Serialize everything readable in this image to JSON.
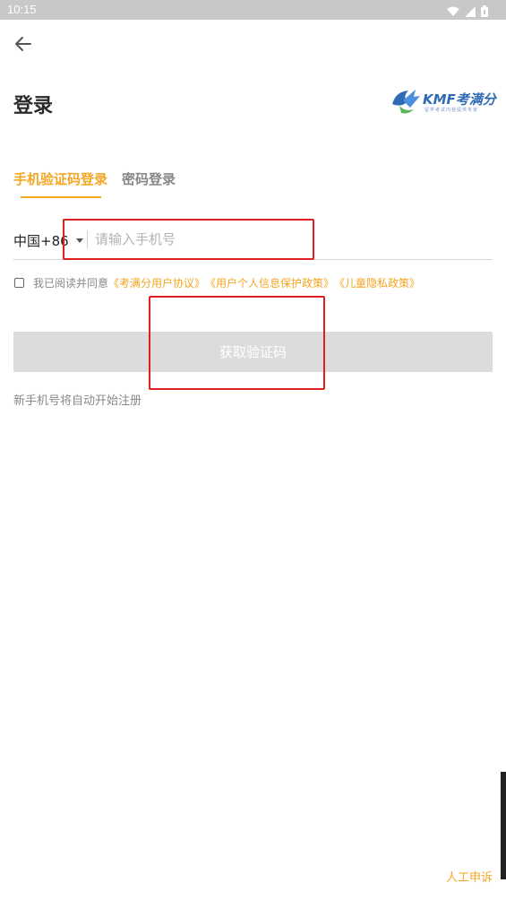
{
  "status_bar": {
    "time": "10:15"
  },
  "header": {
    "title": "登录"
  },
  "logo": {
    "text": "KMF考满分",
    "tagline": "留学考试内容提供专家"
  },
  "tabs": [
    {
      "label": "手机验证码登录",
      "active": true
    },
    {
      "label": "密码登录",
      "active": false
    }
  ],
  "form": {
    "country_code": "中国+86",
    "phone_placeholder": "请输入手机号",
    "agreement_prefix": "我已阅读并同意",
    "agreement_links": [
      "《考满分用户协议》",
      "《用户个人信息保护政策》",
      "《儿童隐私政策》"
    ],
    "get_code_label": "获取验证码",
    "register_hint": "新手机号将自动开始注册"
  },
  "footer": {
    "appeal_label": "人工申诉"
  },
  "colors": {
    "accent": "#f5a623",
    "disabled_button": "#dcdcdc",
    "annotation": "#e02020"
  }
}
